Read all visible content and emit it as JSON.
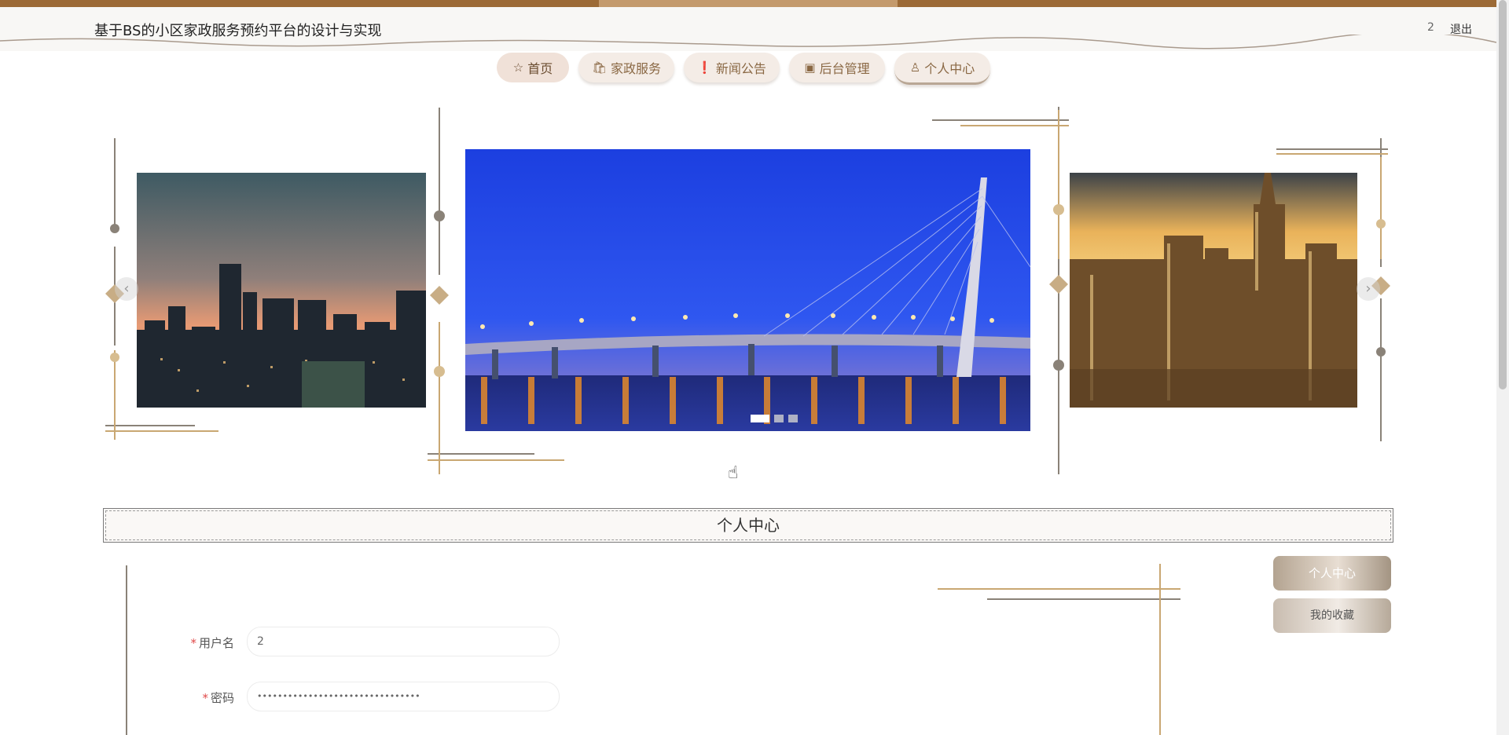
{
  "header": {
    "title": "基于BS的小区家政服务预约平台的设计与实现",
    "user": "2",
    "logout": "退出"
  },
  "nav": [
    {
      "label": "首页",
      "icon": "☆"
    },
    {
      "label": "家政服务",
      "icon": "🛍"
    },
    {
      "label": "新闻公告",
      "icon": "❗"
    },
    {
      "label": "后台管理",
      "icon": "▣"
    },
    {
      "label": "个人中心",
      "icon": "♙"
    }
  ],
  "carousel": {
    "slides": 3,
    "active_index": 0,
    "prev": "‹",
    "next": "›"
  },
  "section": {
    "title": "个人中心"
  },
  "side_menu": {
    "profile": "个人中心",
    "favorites": "我的收藏"
  },
  "form": {
    "username_label": "用户名",
    "username_value": "2",
    "password_label": "密码",
    "password_value": "••••••••••••••••••••••••••••••••"
  },
  "colors": {
    "brand": "#9c6a36",
    "nav_text": "#8a6844",
    "gold": "#c9a772",
    "gray_line": "#8a8278"
  }
}
